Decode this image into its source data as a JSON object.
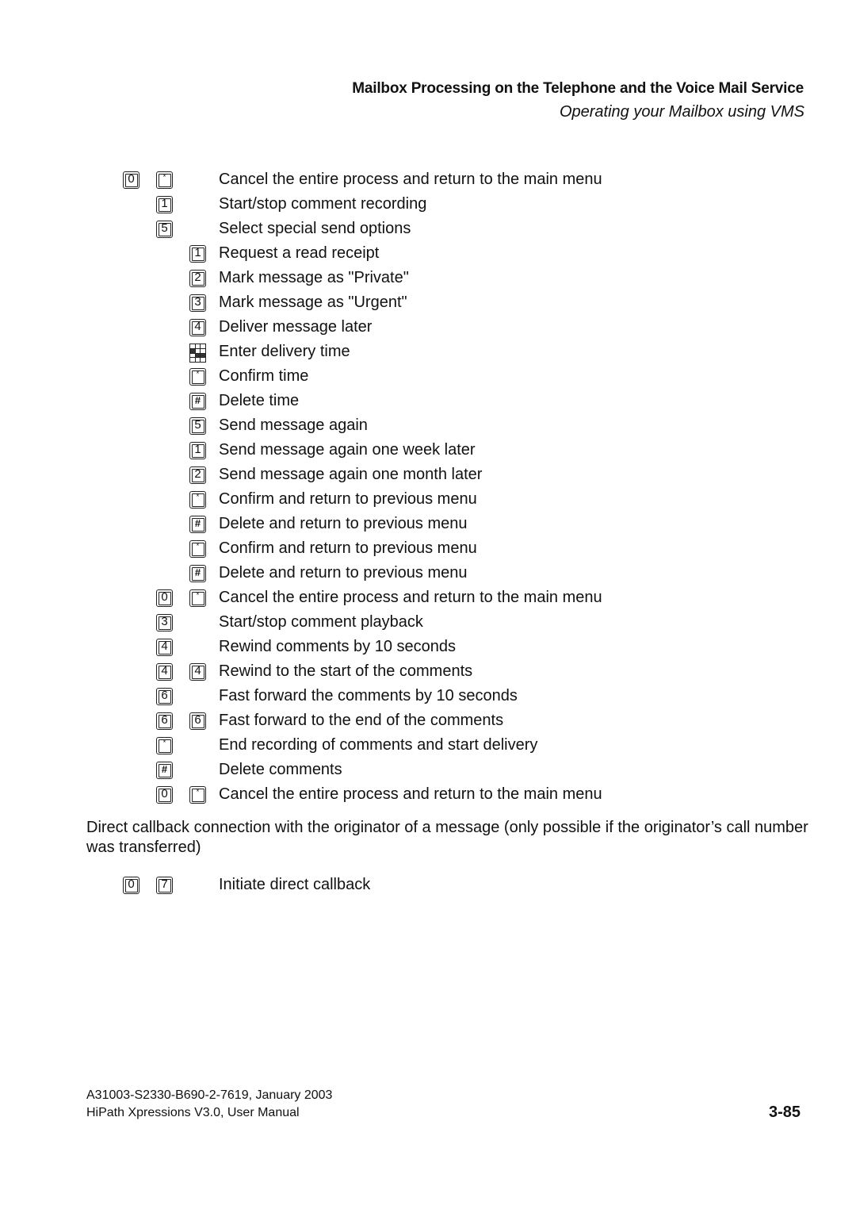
{
  "header": {
    "title": "Mailbox Processing on the Telephone and the Voice Mail Service",
    "subtitle": "Operating your Mailbox using VMS"
  },
  "rows": [
    {
      "keys": [
        {
          "col": 1,
          "label": "0"
        },
        {
          "col": 2,
          "label": "*"
        }
      ],
      "text": "Cancel the entire process and return to the main menu"
    },
    {
      "keys": [
        {
          "col": 2,
          "label": "1"
        }
      ],
      "text": "Start/stop comment recording"
    },
    {
      "keys": [
        {
          "col": 2,
          "label": "5"
        }
      ],
      "text": "Select special send options"
    },
    {
      "keys": [
        {
          "col": 3,
          "label": "1"
        }
      ],
      "text": "Request a read receipt"
    },
    {
      "keys": [
        {
          "col": 3,
          "label": "2"
        }
      ],
      "text": "Mark message as \"Private\""
    },
    {
      "keys": [
        {
          "col": 3,
          "label": "3"
        }
      ],
      "text": "Mark message as \"Urgent\""
    },
    {
      "keys": [
        {
          "col": 3,
          "label": "4"
        }
      ],
      "text": "Deliver message later"
    },
    {
      "keys": [
        {
          "col": 3,
          "label": "keypad"
        }
      ],
      "text": "Enter delivery time"
    },
    {
      "keys": [
        {
          "col": 3,
          "label": "*"
        }
      ],
      "text": "Confirm time"
    },
    {
      "keys": [
        {
          "col": 3,
          "label": "#"
        }
      ],
      "text": "Delete time"
    },
    {
      "keys": [
        {
          "col": 3,
          "label": "5"
        }
      ],
      "text": "Send message again"
    },
    {
      "keys": [
        {
          "col": 3,
          "label": "1"
        }
      ],
      "text": "Send message again one week later"
    },
    {
      "keys": [
        {
          "col": 3,
          "label": "2"
        }
      ],
      "text": "Send message again one month later"
    },
    {
      "keys": [
        {
          "col": 3,
          "label": "*"
        }
      ],
      "text": "Confirm and return to previous menu"
    },
    {
      "keys": [
        {
          "col": 3,
          "label": "#"
        }
      ],
      "text": "Delete and return to previous menu"
    },
    {
      "keys": [
        {
          "col": 3,
          "label": "*"
        }
      ],
      "text": "Confirm and return to previous menu"
    },
    {
      "keys": [
        {
          "col": 3,
          "label": "#"
        }
      ],
      "text": "Delete and return to previous menu"
    },
    {
      "keys": [
        {
          "col": 2,
          "label": "0"
        },
        {
          "col": 3,
          "label": "*"
        }
      ],
      "text": "Cancel the entire process and return to the main menu"
    },
    {
      "keys": [
        {
          "col": 2,
          "label": "3"
        }
      ],
      "text": "Start/stop comment playback"
    },
    {
      "keys": [
        {
          "col": 2,
          "label": "4"
        }
      ],
      "text": "Rewind comments by 10 seconds"
    },
    {
      "keys": [
        {
          "col": 2,
          "label": "4"
        },
        {
          "col": 3,
          "label": "4"
        }
      ],
      "text": "Rewind to the start of the comments"
    },
    {
      "keys": [
        {
          "col": 2,
          "label": "6"
        }
      ],
      "text": "Fast forward the comments by 10 seconds"
    },
    {
      "keys": [
        {
          "col": 2,
          "label": "6"
        },
        {
          "col": 3,
          "label": "6"
        }
      ],
      "text": "Fast forward to the end of the comments"
    },
    {
      "keys": [
        {
          "col": 2,
          "label": "*"
        }
      ],
      "text": "End recording of comments and start delivery"
    },
    {
      "keys": [
        {
          "col": 2,
          "label": "#"
        }
      ],
      "text": "Delete comments"
    },
    {
      "keys": [
        {
          "col": 2,
          "label": "0"
        },
        {
          "col": 3,
          "label": "*"
        }
      ],
      "text": "Cancel the entire process and return to the main menu"
    }
  ],
  "callback": {
    "paragraph": "Direct callback connection with the originator of a message (only possible if the originator’s call number was transferred)",
    "keys": [
      {
        "col": 1,
        "label": "0"
      },
      {
        "col": 2,
        "label": "7"
      }
    ],
    "text": "Initiate direct callback"
  },
  "footer": {
    "doc_number": "A31003-S2330-B690-2-7619, January 2003",
    "manual": "HiPath Xpressions V3.0, User Manual",
    "page": "3-85"
  }
}
